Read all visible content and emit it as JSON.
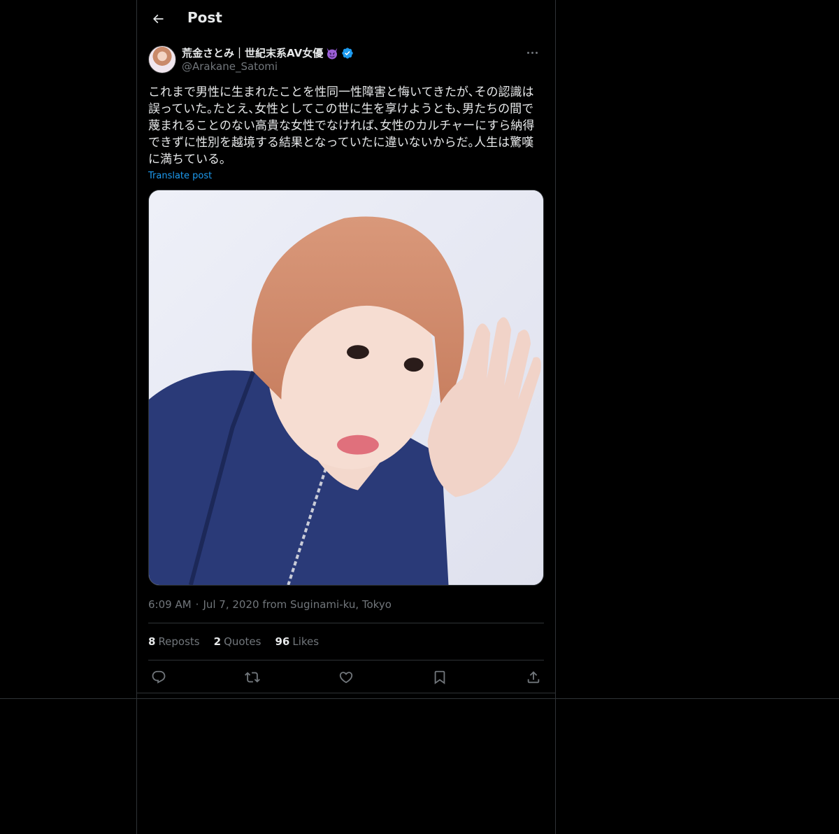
{
  "header": {
    "title": "Post",
    "back_icon": "back-arrow-icon"
  },
  "post": {
    "author": {
      "display_name": "荒金さとみ｜世紀末系AV女優",
      "emoji_icon": "smiling-devil-icon",
      "verified_icon": "verified-badge-icon",
      "handle": "@Arakane_Satomi"
    },
    "text": "これまで男性に生まれたことを性同一性障害と悔いてきたが､その認識は誤っていた｡たとえ､女性としてこの世に生を享けようとも､男たちの間で蔑まれることのない高貴な女性でなければ､女性のカルチャーにすら納得できずに性別を越境する結果となっていたに違いないからだ｡人生は驚嘆に満ちている｡",
    "translate_label": "Translate post",
    "time": "6:09 AM",
    "separator": "·",
    "date_location": "Jul 7, 2020 from Suginami-ku, Tokyo",
    "stats": {
      "reposts_count": "8",
      "reposts_label": "Reposts",
      "quotes_count": "2",
      "quotes_label": "Quotes",
      "likes_count": "96",
      "likes_label": "Likes"
    },
    "actions": [
      "reply-icon",
      "repost-icon",
      "like-icon",
      "bookmark-icon",
      "share-icon"
    ]
  },
  "colors": {
    "background": "#000000",
    "text": "#e7e9ea",
    "muted": "#71767b",
    "accent": "#1d9bf0",
    "border": "#2f3336"
  }
}
